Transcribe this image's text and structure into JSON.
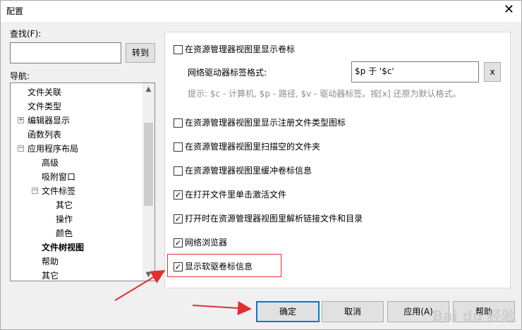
{
  "window": {
    "title": "配置",
    "close_glyph": "✕"
  },
  "search": {
    "label": "查找(F):",
    "value": "",
    "go_button": "转到"
  },
  "nav": {
    "label": "导航:",
    "items": [
      {
        "label": "文件关联"
      },
      {
        "label": "文件类型"
      },
      {
        "label": "编辑器显示",
        "expander": "+"
      },
      {
        "label": "函数列表"
      },
      {
        "label": "应用程序布局",
        "expander": "−"
      },
      {
        "label": "高级"
      },
      {
        "label": "吸附窗口"
      },
      {
        "label": "文件标签",
        "expander": "−"
      },
      {
        "label": "其它"
      },
      {
        "label": "操作"
      },
      {
        "label": "颜色"
      },
      {
        "label": "文件树视图"
      },
      {
        "label": "帮助"
      },
      {
        "label": "其它"
      }
    ],
    "scroll_up": "▲",
    "scroll_down": "▼"
  },
  "options": {
    "show_volume_label": {
      "label": "在资源管理器视图里显示卷标",
      "checked": false,
      "mark": ""
    },
    "net_drive_format_label": "网络驱动器标签格式:",
    "net_drive_format_value": "$p 于 '$c'",
    "clear_button": "x",
    "hint": "提示: $c - 计算机, $p - 路径, $v - 驱动器标签。按[x] 还原为默认格式。",
    "show_registered_icons": {
      "label": "在资源管理器视图里显示注册文件类型图标",
      "checked": false,
      "mark": ""
    },
    "scan_empty_folders": {
      "label": "在资源管理器视图里扫描空的文件夹",
      "checked": false,
      "mark": ""
    },
    "buffer_volume_info": {
      "label": "在资源管理器视图里缓冲卷标信息",
      "checked": false,
      "mark": ""
    },
    "single_click_activate": {
      "label": "在打开文件里单击激活文件",
      "checked": true,
      "mark": "✓"
    },
    "resolve_links": {
      "label": "打开时在资源管理器视图里解析链接文件和目录",
      "checked": true,
      "mark": "✓"
    },
    "network_browser": {
      "label": "网络浏览器",
      "checked": true,
      "mark": "✓"
    },
    "show_floppy_label": {
      "label": "显示软驱卷标信息",
      "checked": true,
      "mark": "✓"
    }
  },
  "buttons": {
    "ok": "确定",
    "cancel": "取消",
    "apply": "应用(A)",
    "help": "帮助"
  },
  "watermark": "Bai du 经验"
}
